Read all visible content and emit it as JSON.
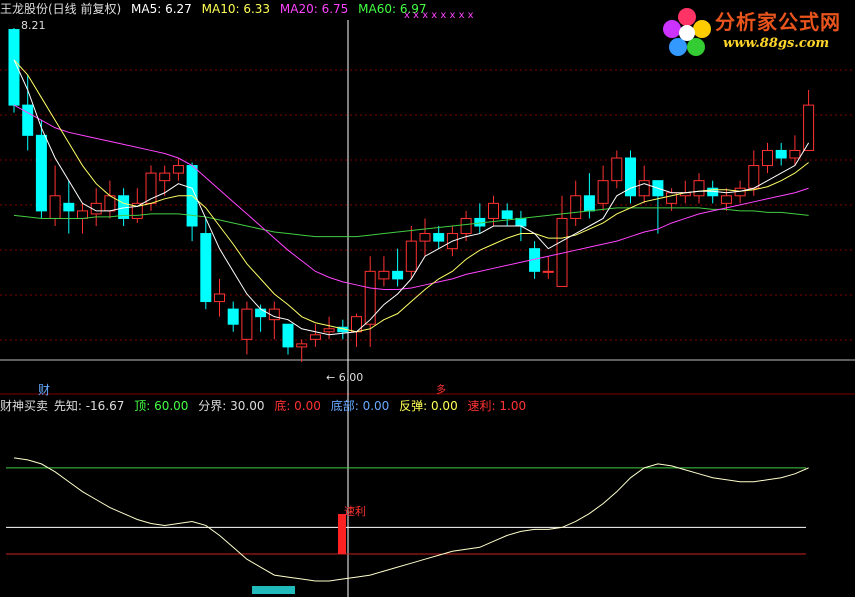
{
  "header": {
    "title": "王龙股份(日线 前复权)",
    "ma5": {
      "label": "MA5: 6.27",
      "color": "#ffffff"
    },
    "ma10": {
      "label": "MA10: 6.33",
      "color": "#ffff55"
    },
    "ma20": {
      "label": "MA20: 6.75",
      "color": "#ff44ff"
    },
    "ma60": {
      "label": "MA60: 6.97",
      "color": "#44ff44"
    }
  },
  "price_panel": {
    "high_label": "8.21",
    "low_label": "6.00",
    "top_markers": "x   x   x   x        x   x   x      x"
  },
  "indicator": {
    "name": "财神买卖",
    "xianzhi": "先知: -16.67",
    "ding": "顶: 60.00",
    "fenjie": "分界: 30.00",
    "di": "底: 0.00",
    "dibu": "底部: 0.00",
    "fantan": "反弹: 0.00",
    "suli": "速利: 1.00",
    "tag_cai": "财",
    "tag_duo": "多",
    "signal_label": "速利"
  },
  "logo": {
    "text": "分析家公式网",
    "url": "www.88gs.com"
  },
  "colors": {
    "up": "#ff3333",
    "down": "#00ffff",
    "grid": "#800000",
    "ma5": "#ffffff",
    "ma10": "#ffff66",
    "ma20": "#ff44ff",
    "ma60": "#44cc44"
  },
  "chart_data": {
    "type": "candlestick",
    "candles": [
      [
        8.2,
        7.7,
        8.21,
        7.65
      ],
      [
        7.7,
        7.5,
        7.9,
        7.4
      ],
      [
        7.5,
        7.0,
        7.6,
        6.95
      ],
      [
        6.95,
        7.1,
        7.3,
        6.9
      ],
      [
        7.05,
        7.0,
        7.2,
        6.85
      ],
      [
        6.95,
        7.0,
        7.05,
        6.85
      ],
      [
        6.98,
        7.05,
        7.15,
        6.9
      ],
      [
        7.0,
        7.1,
        7.2,
        6.95
      ],
      [
        7.1,
        6.95,
        7.15,
        6.9
      ],
      [
        6.95,
        7.05,
        7.15,
        6.92
      ],
      [
        7.05,
        7.25,
        7.3,
        7.0
      ],
      [
        7.2,
        7.25,
        7.3,
        7.1
      ],
      [
        7.25,
        7.3,
        7.35,
        7.2
      ],
      [
        7.3,
        6.9,
        7.32,
        6.8
      ],
      [
        6.85,
        6.4,
        6.95,
        6.35
      ],
      [
        6.4,
        6.45,
        6.55,
        6.3
      ],
      [
        6.35,
        6.25,
        6.4,
        6.2
      ],
      [
        6.15,
        6.35,
        6.4,
        6.05
      ],
      [
        6.35,
        6.3,
        6.38,
        6.2
      ],
      [
        6.28,
        6.35,
        6.4,
        6.15
      ],
      [
        6.25,
        6.1,
        6.25,
        6.05
      ],
      [
        6.1,
        6.12,
        6.15,
        6.0
      ],
      [
        6.15,
        6.18,
        6.25,
        6.1
      ],
      [
        6.2,
        6.22,
        6.3,
        6.15
      ],
      [
        6.23,
        6.2,
        6.28,
        6.15
      ],
      [
        6.2,
        6.3,
        6.32,
        6.1
      ],
      [
        6.25,
        6.6,
        6.7,
        6.1
      ],
      [
        6.55,
        6.6,
        6.7,
        6.5
      ],
      [
        6.6,
        6.55,
        6.75,
        6.5
      ],
      [
        6.6,
        6.8,
        6.9,
        6.55
      ],
      [
        6.8,
        6.85,
        6.95,
        6.7
      ],
      [
        6.85,
        6.8,
        6.9,
        6.75
      ],
      [
        6.75,
        6.85,
        6.9,
        6.7
      ],
      [
        6.85,
        6.95,
        7.0,
        6.8
      ],
      [
        6.95,
        6.9,
        7.05,
        6.85
      ],
      [
        6.95,
        7.05,
        7.1,
        6.9
      ],
      [
        7.0,
        6.95,
        7.05,
        6.9
      ],
      [
        6.95,
        6.9,
        7.0,
        6.8
      ],
      [
        6.75,
        6.6,
        6.8,
        6.55
      ],
      [
        6.6,
        6.6,
        6.7,
        6.55
      ],
      [
        6.5,
        6.95,
        7.1,
        6.5
      ],
      [
        6.95,
        7.1,
        7.2,
        6.9
      ],
      [
        7.1,
        7.0,
        7.25,
        6.95
      ],
      [
        7.05,
        7.2,
        7.3,
        7.0
      ],
      [
        7.2,
        7.35,
        7.4,
        7.15
      ],
      [
        7.35,
        7.1,
        7.4,
        7.05
      ],
      [
        7.1,
        7.2,
        7.3,
        7.05
      ],
      [
        7.2,
        7.1,
        7.2,
        6.85
      ],
      [
        7.05,
        7.12,
        7.15,
        7.0
      ],
      [
        7.1,
        7.12,
        7.2,
        7.05
      ],
      [
        7.1,
        7.2,
        7.25,
        7.05
      ],
      [
        7.15,
        7.1,
        7.2,
        7.05
      ],
      [
        7.05,
        7.1,
        7.15,
        7.0
      ],
      [
        7.1,
        7.15,
        7.2,
        7.05
      ],
      [
        7.15,
        7.3,
        7.4,
        7.1
      ],
      [
        7.3,
        7.4,
        7.45,
        7.25
      ],
      [
        7.4,
        7.35,
        7.45,
        7.3
      ],
      [
        7.35,
        7.4,
        7.5,
        7.3
      ],
      [
        7.4,
        7.7,
        7.8,
        7.4
      ]
    ],
    "ma5": [
      8.0,
      7.8,
      7.55,
      7.35,
      7.2,
      7.05,
      7.0,
      7.0,
      7.02,
      7.03,
      7.08,
      7.12,
      7.18,
      7.15,
      6.95,
      6.75,
      6.6,
      6.45,
      6.35,
      6.3,
      6.28,
      6.22,
      6.2,
      6.18,
      6.19,
      6.2,
      6.28,
      6.38,
      6.45,
      6.55,
      6.7,
      6.75,
      6.8,
      6.83,
      6.85,
      6.9,
      6.9,
      6.9,
      6.85,
      6.75,
      6.8,
      6.85,
      6.9,
      6.95,
      7.1,
      7.15,
      7.18,
      7.15,
      7.12,
      7.12,
      7.13,
      7.13,
      7.12,
      7.13,
      7.15,
      7.2,
      7.25,
      7.3,
      7.45
    ],
    "ma10": [
      8.0,
      7.9,
      7.75,
      7.6,
      7.45,
      7.3,
      7.18,
      7.1,
      7.05,
      7.03,
      7.05,
      7.08,
      7.1,
      7.1,
      7.02,
      6.9,
      6.78,
      6.65,
      6.55,
      6.45,
      6.38,
      6.3,
      6.26,
      6.24,
      6.22,
      6.2,
      6.22,
      6.28,
      6.32,
      6.4,
      6.48,
      6.55,
      6.6,
      6.68,
      6.74,
      6.78,
      6.82,
      6.85,
      6.85,
      6.82,
      6.82,
      6.84,
      6.88,
      6.92,
      6.98,
      7.02,
      7.06,
      7.08,
      7.1,
      7.12,
      7.13,
      7.14,
      7.14,
      7.13,
      7.14,
      7.16,
      7.2,
      7.25,
      7.32
    ],
    "ma20": [
      7.7,
      7.65,
      7.6,
      7.55,
      7.52,
      7.5,
      7.48,
      7.46,
      7.44,
      7.42,
      7.4,
      7.38,
      7.35,
      7.3,
      7.22,
      7.14,
      7.06,
      6.98,
      6.9,
      6.82,
      6.74,
      6.67,
      6.6,
      6.56,
      6.53,
      6.51,
      6.49,
      6.48,
      6.48,
      6.49,
      6.51,
      6.53,
      6.55,
      6.58,
      6.6,
      6.62,
      6.64,
      6.66,
      6.68,
      6.7,
      6.72,
      6.74,
      6.76,
      6.78,
      6.8,
      6.83,
      6.86,
      6.88,
      6.92,
      6.95,
      6.98,
      7.0,
      7.02,
      7.04,
      7.06,
      7.08,
      7.1,
      7.12,
      7.15
    ],
    "ma60": [
      6.97,
      6.96,
      6.95,
      6.95,
      6.95,
      6.95,
      6.96,
      6.96,
      6.97,
      6.97,
      6.98,
      6.98,
      6.98,
      6.97,
      6.96,
      6.94,
      6.92,
      6.9,
      6.88,
      6.86,
      6.85,
      6.84,
      6.83,
      6.83,
      6.83,
      6.83,
      6.84,
      6.85,
      6.86,
      6.87,
      6.88,
      6.89,
      6.9,
      6.91,
      6.92,
      6.93,
      6.94,
      6.95,
      6.96,
      6.97,
      6.98,
      6.99,
      7.0,
      7.01,
      7.02,
      7.02,
      7.02,
      7.02,
      7.02,
      7.02,
      7.02,
      7.01,
      7.01,
      7.0,
      7.0,
      6.99,
      6.99,
      6.98,
      6.97
    ],
    "oscillator": [
      65,
      64,
      62,
      58,
      53,
      48,
      44,
      40,
      37,
      34,
      32,
      31,
      32,
      33,
      31,
      26,
      20,
      14,
      10,
      6,
      5,
      4,
      3,
      3,
      4,
      5,
      6,
      8,
      10,
      12,
      14,
      16,
      18,
      19,
      20,
      23,
      26,
      28,
      29,
      29,
      30,
      33,
      37,
      42,
      48,
      55,
      60,
      62,
      61,
      59,
      57,
      55,
      54,
      53,
      53,
      54,
      55,
      57,
      60
    ],
    "oscillator_levels": {
      "ding": 60,
      "fenjie": 30,
      "di": 0
    }
  }
}
